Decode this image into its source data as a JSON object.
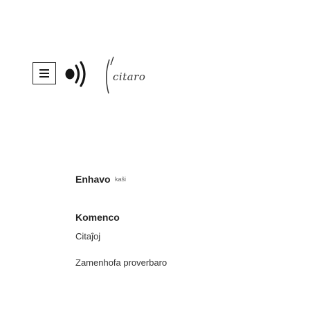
{
  "header": {
    "menu_button_icon": "hamburger-menu-icon",
    "logo_icon": "speaker-sound-waves-icon",
    "logo_text": "citaro"
  },
  "nav": {
    "link_label": "Enhavo",
    "lang_badge": "kaŝi"
  },
  "menu": {
    "items": [
      {
        "label": "Komenco"
      },
      {
        "label": "Citaĵoj"
      },
      {
        "label": "Zamenhofa proverbaro"
      }
    ]
  }
}
